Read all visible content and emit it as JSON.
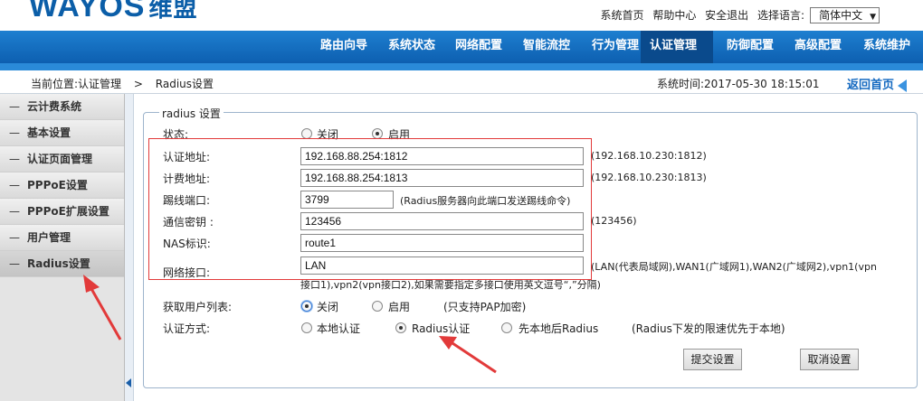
{
  "brand": {
    "name": "WAYOS",
    "cn": "维盟"
  },
  "toplinks": [
    "系统首页",
    "帮助中心",
    "安全退出",
    "选择语言:"
  ],
  "language": {
    "selected": "简体中文"
  },
  "nav": [
    "路由向导",
    "系统状态",
    "网络配置",
    "智能流控",
    "行为管理",
    "认证管理",
    "防御配置",
    "高级配置",
    "系统维护"
  ],
  "breadcrumb": {
    "label": "当前位置:",
    "section": "认证管理",
    "sep": ">",
    "page": "Radius设置"
  },
  "systime": "系统时间:2017-05-30 18:15:01",
  "home": "返回首页",
  "sidebar": [
    "云计费系统",
    "基本设置",
    "认证页面管理",
    "PPPoE设置",
    "PPPoE扩展设置",
    "用户管理",
    "Radius设置"
  ],
  "form": {
    "legend": "radius 设置",
    "status": {
      "label": "状态:",
      "off": "关闭",
      "on": "启用"
    },
    "auth_addr": {
      "label": "认证地址:",
      "value": "192.168.88.254:1812",
      "hint": "(192.168.10.230:1812)"
    },
    "acct_addr": {
      "label": "计费地址:",
      "value": "192.168.88.254:1813",
      "hint": "(192.168.10.230:1813)"
    },
    "kick_port": {
      "label": "踢线端口:",
      "value": "3799",
      "hint": "(Radius服务器向此端口发送踢线命令)"
    },
    "secret": {
      "label": "通信密钥 :",
      "value": "123456",
      "hint": "(123456)"
    },
    "nas_id": {
      "label": "NAS标识:",
      "value": "route1"
    },
    "iface": {
      "label": "网络接口:",
      "value": "LAN",
      "hint1": "(LAN(代表局域网),WAN1(广域网1),WAN2(广域网2),vpn1(vpn",
      "hint2": "接口1),vpn2(vpn接口2),如果需要指定多接口使用英文逗号“,”分隔)"
    },
    "userlist": {
      "label": "获取用户列表:",
      "off": "关闭",
      "on": "启用",
      "note": "(只支持PAP加密)"
    },
    "auth_mode": {
      "label": "认证方式:",
      "local": "本地认证",
      "radius": "Radius认证",
      "both": "先本地后Radius",
      "note": "(Radius下发的限速优先于本地)"
    },
    "submit": "提交设置",
    "cancel": "取消设置"
  },
  "colors": {
    "nav_blue": "#0d5fb0",
    "accent_red": "#e23a3a",
    "link_blue": "#1469c0"
  }
}
